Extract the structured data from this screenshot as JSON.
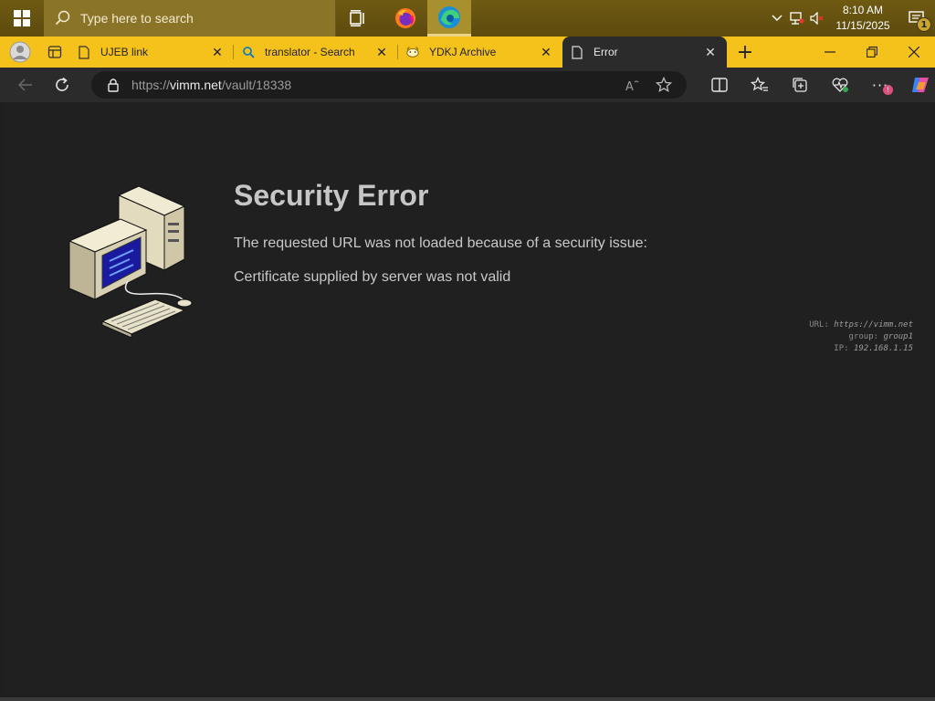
{
  "taskbar": {
    "search_placeholder": "Type here to search",
    "apps": [
      "task-view",
      "firefox",
      "edge"
    ],
    "clock_time": "8:10 AM",
    "clock_date": "11/15/2025",
    "notification_count": "1"
  },
  "browser": {
    "tabs": [
      {
        "title": "UJEB link",
        "favicon": "page-icon",
        "active": false
      },
      {
        "title": "translator - Search",
        "favicon": "search-icon",
        "active": false
      },
      {
        "title": "YDKJ Archive",
        "favicon": "hand-icon",
        "active": false
      },
      {
        "title": "Error",
        "favicon": "page-icon",
        "active": true
      }
    ],
    "new_tab_label": "+",
    "address_prefix": "https://",
    "address_host": "vimm.net",
    "address_path": "/vault/18338",
    "extension_badge": "!",
    "accent_color": "#f5c21b"
  },
  "page": {
    "title": "Security Error",
    "line1": "The requested URL was not loaded because of a security issue:",
    "line2": "Certificate supplied by server was not valid",
    "diag_url_label": "URL:",
    "diag_url_value": "https://vimm.net",
    "diag_group_label": "group:",
    "diag_group_value": "group1",
    "diag_ip_label": "IP:",
    "diag_ip_value": "192.168.1.15"
  }
}
